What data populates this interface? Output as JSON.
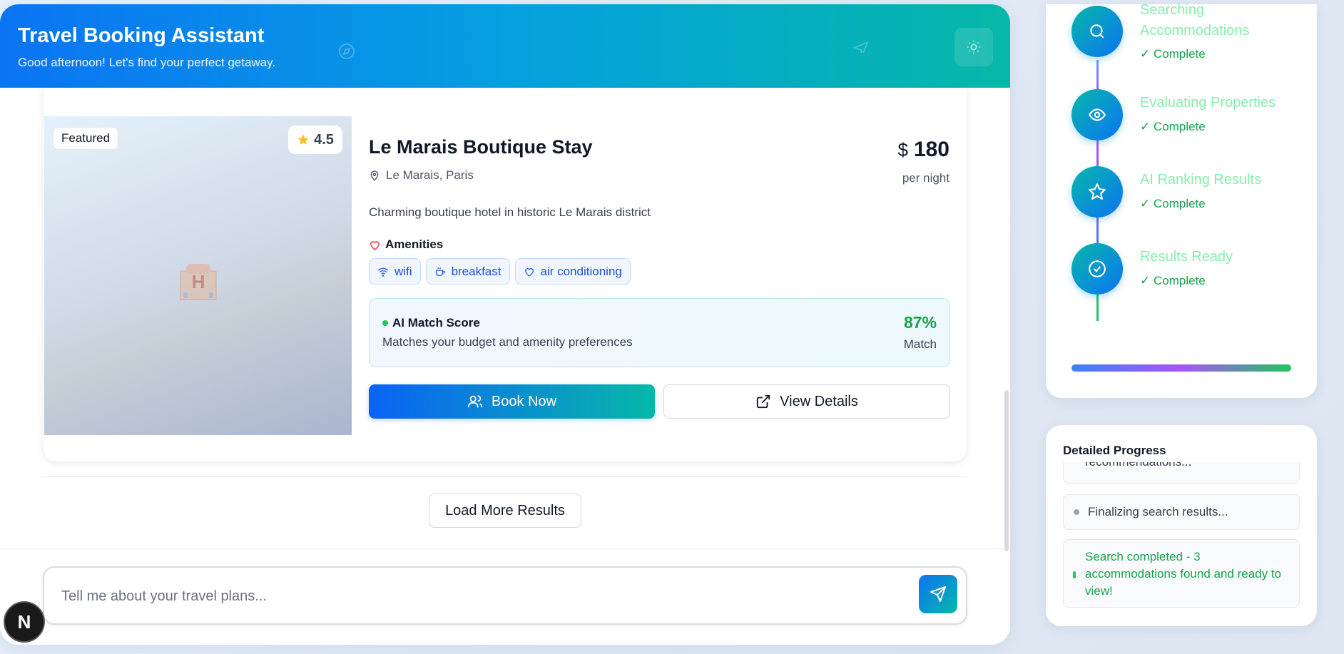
{
  "header": {
    "title": "Travel Booking Assistant",
    "subtitle": "Good afternoon! Let's find your perfect getaway."
  },
  "listing": {
    "badge": "Featured",
    "rating": "4.5",
    "name": "Le Marais Boutique Stay",
    "location": "Le Marais, Paris",
    "currency": "$",
    "price": "180",
    "price_unit": "per night",
    "description": "Charming boutique hotel in historic Le Marais district",
    "amenities_heading": "Amenities",
    "amenities": [
      {
        "label": "wifi",
        "icon": "wifi-icon"
      },
      {
        "label": "breakfast",
        "icon": "coffee-icon"
      },
      {
        "label": "air conditioning",
        "icon": "heart-icon"
      }
    ],
    "match": {
      "label": "AI Match Score",
      "reason": "Matches your budget and amenity preferences",
      "percent": "87%",
      "percent_value": 87,
      "suffix": "Match"
    },
    "book_label": "Book Now",
    "view_label": "View Details"
  },
  "load_more_label": "Load More Results",
  "chat": {
    "placeholder": "Tell me about your travel plans...",
    "value": ""
  },
  "nav_logo": "N",
  "steps": [
    {
      "title": "Searching Accommodations",
      "status": "✓ Complete",
      "icon": "search-icon"
    },
    {
      "title": "Evaluating Properties",
      "status": "✓ Complete",
      "icon": "eye-icon"
    },
    {
      "title": "AI Ranking Results",
      "status": "✓ Complete",
      "icon": "star-icon"
    },
    {
      "title": "Results Ready",
      "status": "✓ Complete",
      "icon": "check-circle-icon"
    }
  ],
  "progress_fraction": 1.0,
  "detailed": {
    "heading": "Detailed Progress",
    "logs": [
      {
        "text": "recommendations..."
      },
      {
        "text": "Finalizing search results..."
      },
      {
        "text": "Search completed - 3 accommodations found and ready to view!"
      }
    ]
  },
  "colors": {
    "accent_blue": "#0b74f4",
    "accent_teal": "#06b8a8",
    "success": "#16a34a",
    "step_title": "#86efac"
  }
}
